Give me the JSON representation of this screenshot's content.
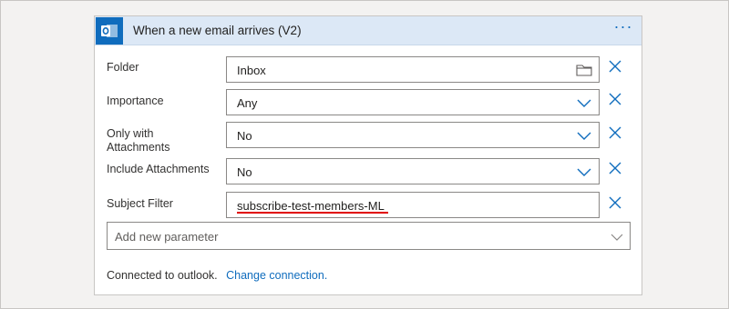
{
  "trigger": {
    "title": "When a new email arrives (V2)",
    "app_icon": "outlook-icon",
    "more_label": "···"
  },
  "fields": [
    {
      "label": "Folder",
      "value": "Inbox",
      "control": "folder-picker"
    },
    {
      "label": "Importance",
      "value": "Any",
      "control": "dropdown"
    },
    {
      "label_line1": "Only with",
      "label_line2": "Attachments",
      "value": "No",
      "control": "dropdown"
    },
    {
      "label": "Include Attachments",
      "value": "No",
      "control": "dropdown"
    },
    {
      "label": "Subject Filter",
      "value": "subscribe-test-members-ML",
      "control": "text"
    }
  ],
  "add_parameter": {
    "placeholder": "Add new parameter"
  },
  "footer": {
    "connected_text": "Connected to outlook.",
    "change_link": "Change connection."
  },
  "colors": {
    "accent": "#0f6cbd",
    "header_bg": "#dce8f6",
    "underline": "#e00000"
  }
}
